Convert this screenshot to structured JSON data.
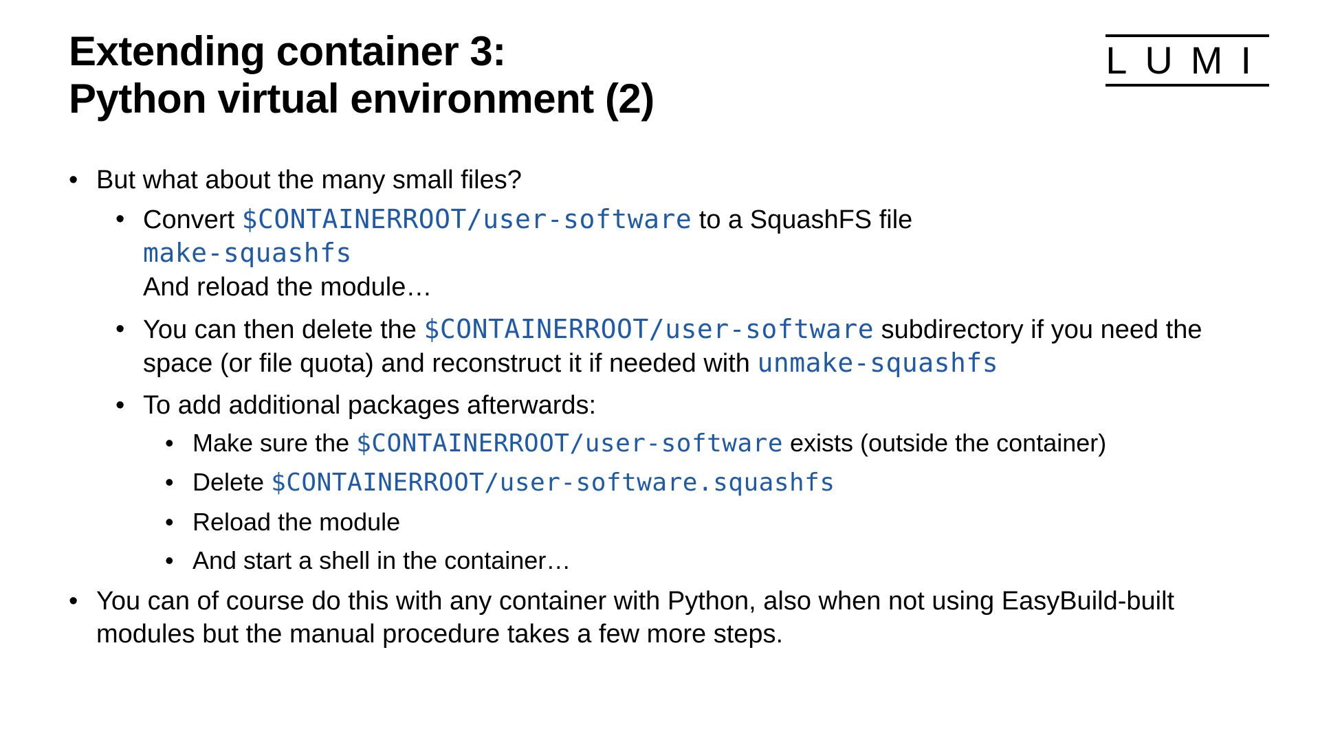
{
  "title": {
    "line1": "Extending container 3:",
    "line2": "Python virtual environment (2)"
  },
  "logo": "LUMI",
  "code": {
    "containerroot_user_software": "$CONTAINERROOT/user-software",
    "make_squashfs": "make-squashfs",
    "unmake_squashfs": "unmake-squashfs",
    "user_software_squashfs": "$CONTAINERROOT/user-software.squashfs"
  },
  "bullets": {
    "l1_a": "But what about the many small files?",
    "l2_a_pre": "Convert ",
    "l2_a_mid": " to a SquashFS file",
    "l2_a_post": "And reload the module…",
    "l2_b_pre": "You can then delete the ",
    "l2_b_mid": " subdirectory if you need the space (or file quota) and reconstruct it if needed with ",
    "l2_c": "To add additional packages afterwards:",
    "l3_a_pre": "Make sure the ",
    "l3_a_post": " exists (outside the container)",
    "l3_b_pre": "Delete ",
    "l3_c": "Reload the module",
    "l3_d": "And start a shell in the container…",
    "l1_b": "You can of course do this with any container with Python, also when not using EasyBuild-built modules but the manual procedure takes a few more steps."
  }
}
